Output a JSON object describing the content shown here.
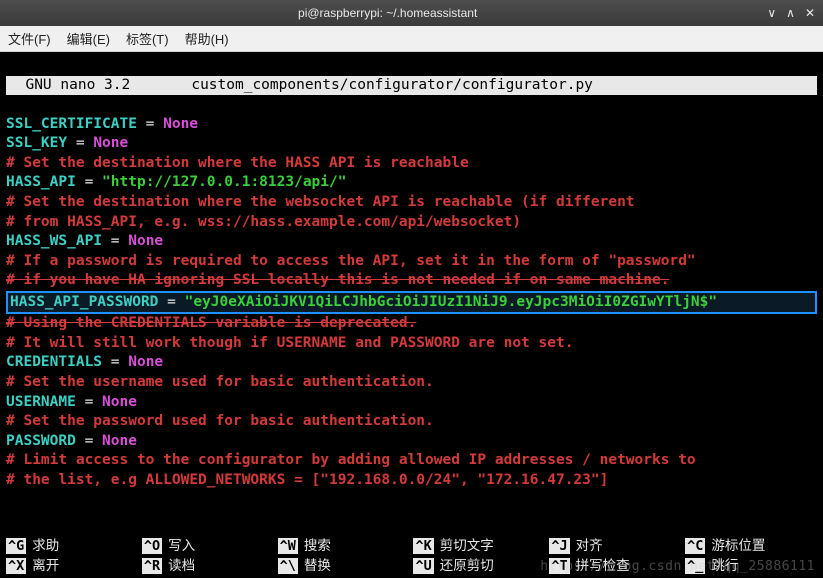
{
  "titlebar": {
    "text": "pi@raspberrypi: ~/.homeassistant"
  },
  "menu": {
    "file": "文件(F)",
    "edit": "编辑(E)",
    "tabs": "标签(T)",
    "help": "帮助(H)"
  },
  "nano": {
    "app": "GNU nano 3.2",
    "file": "custom_components/configurator/configurator.py"
  },
  "code": {
    "ssl_cert": {
      "var": "SSL_CERTIFICATE",
      "eq": " = ",
      "val": "None"
    },
    "ssl_key": {
      "var": "SSL_KEY",
      "eq": " = ",
      "val": "None"
    },
    "c1": "# Set the destination where the HASS API is reachable",
    "hass_api": {
      "var": "HASS_API",
      "eq": " = ",
      "val": "\"http://127.0.0.1:8123/api/\""
    },
    "c2a": "# Set the destination where the websocket API is reachable (if different",
    "c2b": "# from HASS_API, e.g. wss://hass.example.com/api/websocket)",
    "hass_ws": {
      "var": "HASS_WS_API",
      "eq": " = ",
      "val": "None"
    },
    "c3a": "# If a password is required to access the API, set it in the form of \"password\"",
    "c3b": "# if you have HA ignoring SSL locally this is not needed if on same machine.",
    "hass_pw": {
      "var": "HASS_API_PASSWORD",
      "eq": " = ",
      "val": "\"eyJ0eXAiOiJKV1QiLCJhbGciOiJIUzI1NiJ9.eyJpc3MiOiI0ZGIwYTljN$\""
    },
    "c4": "# Using the CREDENTIALS variable is deprecated.",
    "c5": "# It will still work though if USERNAME and PASSWORD are not set.",
    "creds": {
      "var": "CREDENTIALS",
      "eq": " = ",
      "val": "None"
    },
    "c6": "# Set the username used for basic authentication.",
    "user": {
      "var": "USERNAME",
      "eq": " = ",
      "val": "None"
    },
    "c7": "# Set the password used for basic authentication.",
    "pass": {
      "var": "PASSWORD",
      "eq": " = ",
      "val": "None"
    },
    "c8a": "# Limit access to the configurator by adding allowed IP addresses / networks to",
    "c8b": "# the list, e.g ALLOWED_NETWORKS = [\"192.168.0.0/24\", \"172.16.47.23\"]"
  },
  "shortcuts": {
    "r1": [
      {
        "k": "^G",
        "l": "求助"
      },
      {
        "k": "^O",
        "l": "写入"
      },
      {
        "k": "^W",
        "l": "搜索"
      },
      {
        "k": "^K",
        "l": "剪切文字"
      },
      {
        "k": "^J",
        "l": "对齐"
      },
      {
        "k": "^C",
        "l": "游标位置"
      }
    ],
    "r2": [
      {
        "k": "^X",
        "l": "离开"
      },
      {
        "k": "^R",
        "l": "读档"
      },
      {
        "k": "^\\",
        "l": "替换"
      },
      {
        "k": "^U",
        "l": "还原剪切"
      },
      {
        "k": "^T",
        "l": "拼写检查"
      },
      {
        "k": "^_",
        "l": "跳行"
      }
    ]
  },
  "watermark": "https://blog.csdn.net/qq_25886111"
}
